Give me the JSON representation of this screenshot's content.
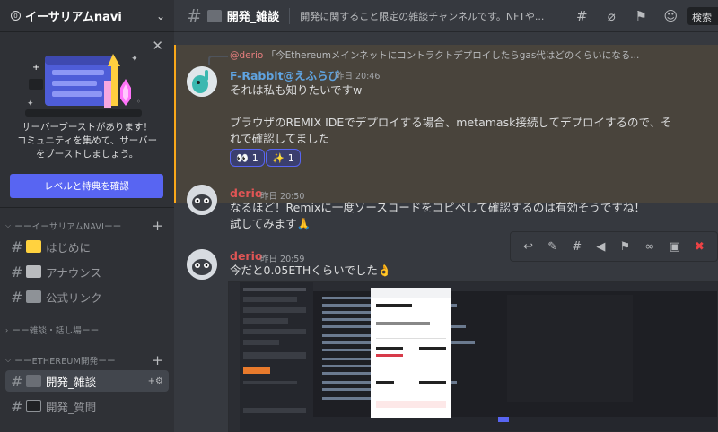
{
  "server": {
    "name": "イーサリアムnavi",
    "badge": "0"
  },
  "boost": {
    "text_line1": "サーバーブーストがあります！",
    "text_line2": "コミュニティを集めて、サーバー",
    "text_line3": "をブーストしましょう。",
    "button": "レベルと特典を確認"
  },
  "categories": [
    {
      "label": "ーーイーサリアムNAVIーー"
    },
    {
      "label": "ーー雑談・話し場ーー"
    },
    {
      "label": "ーーETHEREUM開発ーー"
    }
  ],
  "channels": [
    {
      "label": "はじめに",
      "emoji": "🔰"
    },
    {
      "label": "アナウンス",
      "emoji": "📢"
    },
    {
      "label": "公式リンク",
      "emoji": "📎"
    },
    {
      "label": "開発_雑談",
      "emoji": "⛓"
    },
    {
      "label": "開発_質問",
      "emoji": "💻"
    }
  ],
  "header": {
    "channel": "開発_雑談",
    "topic": "開発に関すること限定の雑談チャンネルです。NFTや...",
    "search_placeholder": "検索"
  },
  "messages": [
    {
      "reply_mention": "@derio",
      "reply_text": "「今Ethereumメインネットにコントラクトデプロイしたらgas代はどのくらいになる...",
      "user": "F-Rabbit@えふらび",
      "user_color": "#5fa3e0",
      "time": "昨日 20:46",
      "line1": "それは私も知りたいですw",
      "line2": "ブラウザのREMIX IDEでデプロイする場合、metamask接続してデプロイするので、そ",
      "line3": "れで確認してました",
      "reactions": [
        {
          "emoji": "👀",
          "count": "1"
        },
        {
          "emoji": "✨",
          "count": "1"
        }
      ]
    },
    {
      "user": "derio",
      "user_color": "#e05555",
      "time": "昨日 20:50",
      "line1": "なるほど！Remixに一度ソースコードをコピペして確認するのは有効そうですね！",
      "line2": "試してみます🙏"
    },
    {
      "user": "derio",
      "user_color": "#e05555",
      "time": "昨日 20:59",
      "line1": "今だと0.05ETHくらいでした👌"
    }
  ]
}
